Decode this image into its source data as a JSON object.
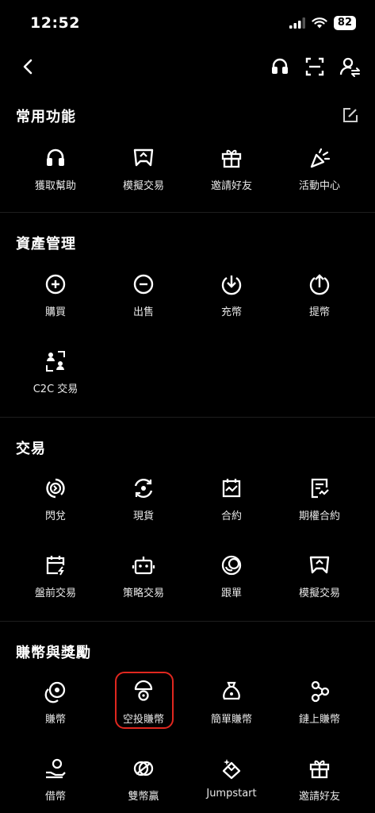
{
  "status_bar": {
    "time": "12:52",
    "battery": "82"
  },
  "sections": [
    {
      "title": "常用功能",
      "items": [
        {
          "label": "獲取幫助",
          "icon": "headset-icon"
        },
        {
          "label": "模擬交易",
          "icon": "demo-trading-icon"
        },
        {
          "label": "邀請好友",
          "icon": "gift-icon"
        },
        {
          "label": "活動中心",
          "icon": "party-popper-icon"
        }
      ]
    },
    {
      "title": "資產管理",
      "items": [
        {
          "label": "購買",
          "icon": "plus-circle-icon"
        },
        {
          "label": "出售",
          "icon": "minus-circle-icon"
        },
        {
          "label": "充幣",
          "icon": "deposit-icon"
        },
        {
          "label": "提幣",
          "icon": "withdraw-icon"
        },
        {
          "label": "C2C 交易",
          "icon": "c2c-icon"
        }
      ]
    },
    {
      "title": "交易",
      "items": [
        {
          "label": "閃兌",
          "icon": "convert-icon"
        },
        {
          "label": "現貨",
          "icon": "spot-icon"
        },
        {
          "label": "合約",
          "icon": "futures-icon"
        },
        {
          "label": "期權合約",
          "icon": "options-icon"
        },
        {
          "label": "盤前交易",
          "icon": "pre-market-icon"
        },
        {
          "label": "策略交易",
          "icon": "bot-icon"
        },
        {
          "label": "跟單",
          "icon": "copy-trading-icon"
        },
        {
          "label": "模擬交易",
          "icon": "demo-trading-icon"
        }
      ]
    },
    {
      "title": "賺幣與獎勵",
      "items": [
        {
          "label": "賺幣",
          "icon": "earn-icon"
        },
        {
          "label": "空投賺幣",
          "icon": "airdrop-icon"
        },
        {
          "label": "簡單賺幣",
          "icon": "money-bag-icon"
        },
        {
          "label": "鏈上賺幣",
          "icon": "onchain-icon"
        },
        {
          "label": "借幣",
          "icon": "loan-icon"
        },
        {
          "label": "雙幣贏",
          "icon": "dual-investment-icon"
        },
        {
          "label": "Jumpstart",
          "icon": "jumpstart-icon"
        },
        {
          "label": "邀請好友",
          "icon": "gift-icon"
        }
      ]
    }
  ],
  "highlight_color": "#e0271f"
}
